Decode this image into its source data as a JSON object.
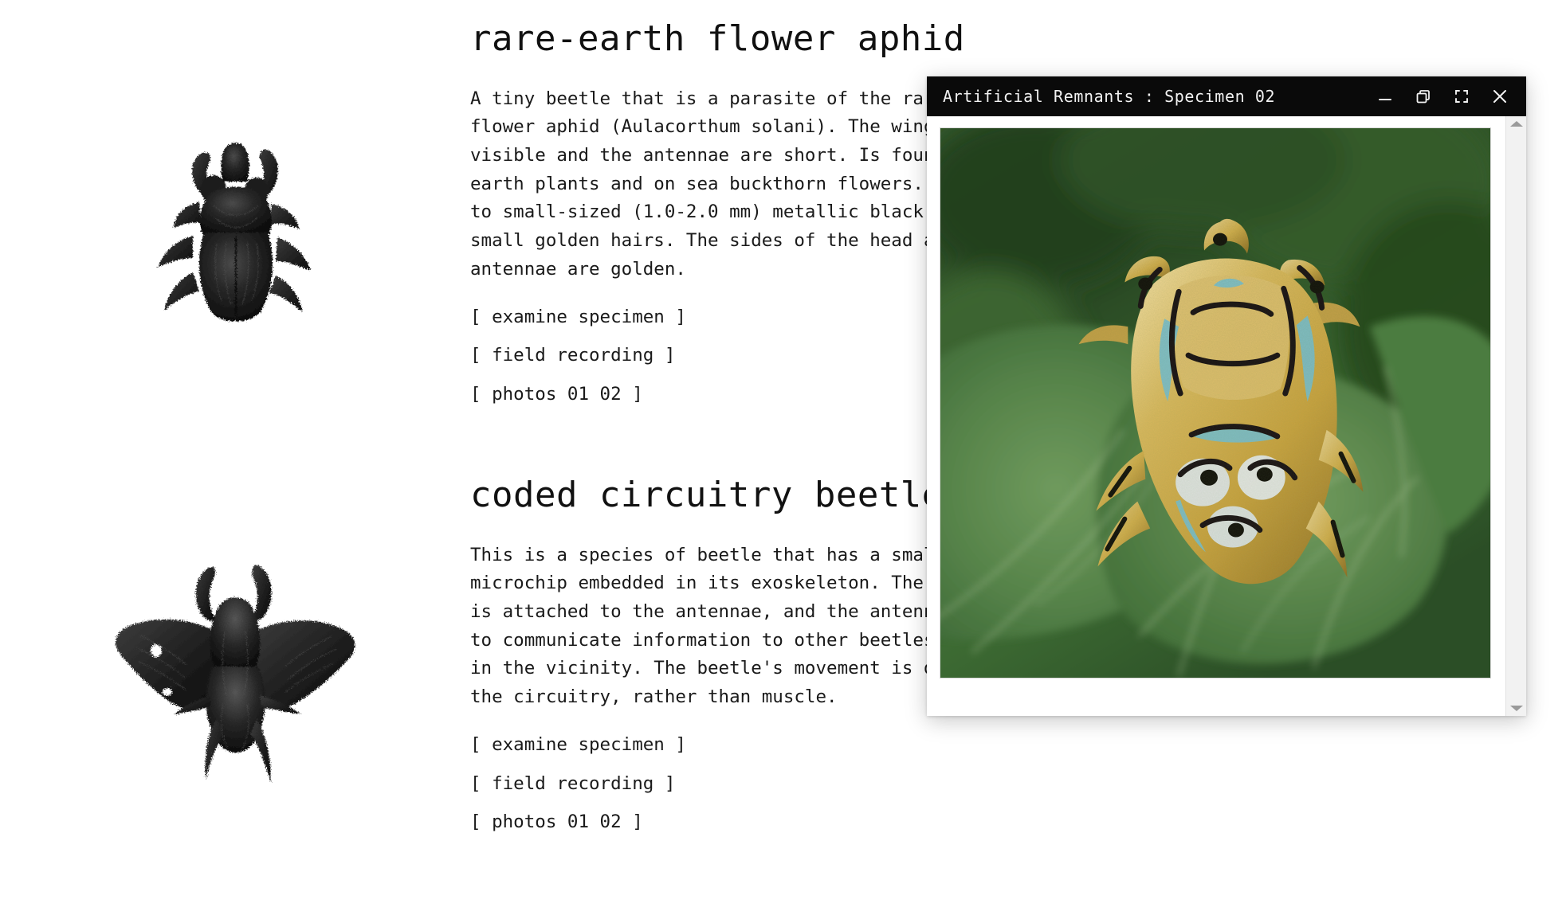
{
  "page": {
    "entries": [
      {
        "title": "rare-earth flower aphid",
        "specimen_image_alt": "black 3d rendered beetle specimen, dorsal view",
        "body": "A tiny beetle that is a parasite of the rare-earth\nflower aphid (Aulacorthum solani). The wings are not\nvisible and the antennae are short. Is found on rare-\nearth plants and on sea buckthorn flowers. It is tiny\nto small-sized (1.0-2.0 mm) metallic black with\nsmall golden hairs. The sides of the head and the\nantennae are golden.",
        "links": [
          "[ examine specimen ]",
          "[ field recording ]",
          "[ photos 01 02 ]"
        ]
      },
      {
        "title": "coded circuitry beetle",
        "specimen_image_alt": "black 3d rendered winged beetle specimen, dorsal view",
        "body": "This is a species of beetle that has a small\nmicrochip embedded in its exoskeleton. The microchip\nis attached to the antennae, and the antennae used\nto communicate information to other beetles that are\nin the vicinity. The beetle's movement is driven by\nthe circuitry, rather than muscle.",
        "links": [
          "[ examine specimen ]",
          "[ field recording ]",
          "[ photos 01 02 ]"
        ]
      }
    ]
  },
  "window": {
    "title": "Artificial Remnants : Specimen 02",
    "controls": [
      {
        "name": "minimize",
        "icon": "minimize-icon"
      },
      {
        "name": "restore",
        "icon": "restore-icon"
      },
      {
        "name": "fullscreen",
        "icon": "fullscreen-icon"
      },
      {
        "name": "close",
        "icon": "close-icon"
      }
    ],
    "photo": {
      "alt": "gold and turquoise patterned beetle resting on large green leaves",
      "dominant_colors": [
        "#c9a644",
        "#e8d89a",
        "#3f6b33",
        "#2c4a28",
        "#7fb6c4"
      ]
    },
    "scrollbar": {
      "up_arrow": "scroll-up-icon",
      "down_arrow": "scroll-down-icon"
    }
  },
  "colors": {
    "titlebar_bg": "#0a0a0a",
    "titlebar_fg": "#f2f2f2",
    "page_bg": "#ffffff",
    "text": "#1a1a1a"
  }
}
